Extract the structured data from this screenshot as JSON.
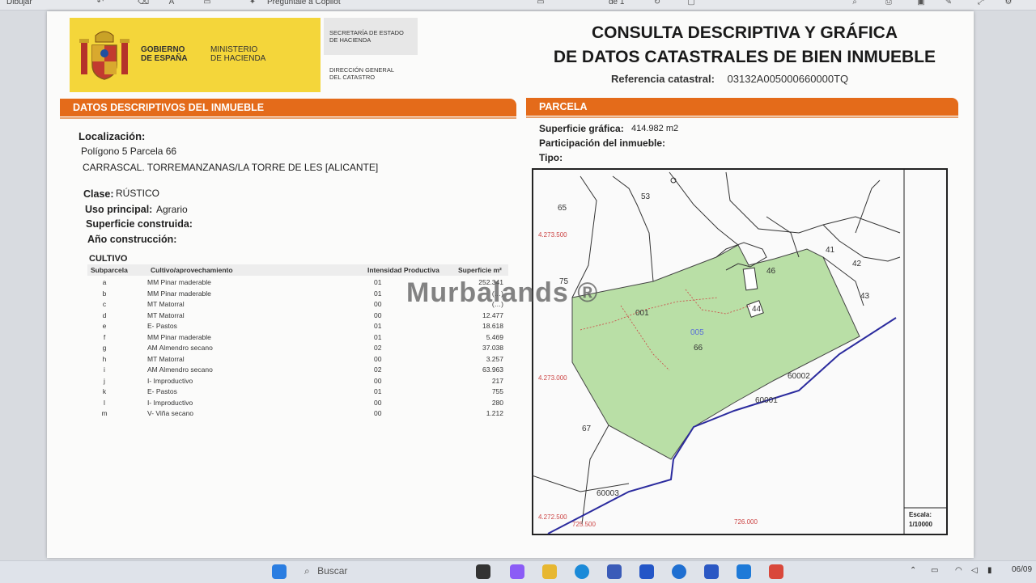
{
  "toolbar": {
    "draw_label": "Dibujar",
    "copilot_label": "Pregúntale a Copilot",
    "page_of": "de 1"
  },
  "header": {
    "gov_line1": "Gobierno",
    "gov_line2": "de España",
    "min_line1": "Ministerio",
    "min_line2": "de Hacienda",
    "sec_line1": "Secretaría de Estado",
    "sec_line2": "de Hacienda",
    "dir_line1": "Dirección General",
    "dir_line2": "del Catastro",
    "title_line1": "CONSULTA DESCRIPTIVA Y GRÁFICA",
    "title_line2": "DE DATOS CATASTRALES DE BIEN INMUEBLE",
    "ref_label": "Referencia catastral:",
    "ref_value": "03132A005000660000TQ"
  },
  "descriptivos": {
    "section_title": "DATOS DESCRIPTIVOS DEL INMUEBLE",
    "localizacion_label": "Localización:",
    "localizacion_line1": "Polígono 5 Parcela 66",
    "localizacion_line2": "CARRASCAL. TORREMANZANAS/LA TORRE DE LES [ALICANTE]",
    "clase_label": "Clase:",
    "clase_value": "RÚSTICO",
    "uso_label": "Uso principal:",
    "uso_value": "Agrario",
    "superficie_label": "Superficie construida:",
    "anio_label": "Año construcción:"
  },
  "cultivo": {
    "title": "CULTIVO",
    "headers": {
      "subparcela": "Subparcela",
      "cultivo": "Cultivo/aprovechamiento",
      "intensidad": "Intensidad Productiva",
      "superficie": "Superficie m²"
    },
    "rows": [
      {
        "sp": "a",
        "cultivo": "MM Pinar maderable",
        "ip": "01",
        "sup": "252.341"
      },
      {
        "sp": "b",
        "cultivo": "MM Pinar maderable",
        "ip": "01",
        "sup": "(…)"
      },
      {
        "sp": "c",
        "cultivo": "MT Matorral",
        "ip": "00",
        "sup": "(…)"
      },
      {
        "sp": "d",
        "cultivo": "MT Matorral",
        "ip": "00",
        "sup": "12.477"
      },
      {
        "sp": "e",
        "cultivo": "E- Pastos",
        "ip": "01",
        "sup": "18.618"
      },
      {
        "sp": "f",
        "cultivo": "MM Pinar maderable",
        "ip": "01",
        "sup": "5.469"
      },
      {
        "sp": "g",
        "cultivo": "AM Almendro secano",
        "ip": "02",
        "sup": "37.038"
      },
      {
        "sp": "h",
        "cultivo": "MT Matorral",
        "ip": "00",
        "sup": "3.257"
      },
      {
        "sp": "i",
        "cultivo": "AM Almendro secano",
        "ip": "02",
        "sup": "63.963"
      },
      {
        "sp": "j",
        "cultivo": "I- Improductivo",
        "ip": "00",
        "sup": "217"
      },
      {
        "sp": "k",
        "cultivo": "E- Pastos",
        "ip": "01",
        "sup": "755"
      },
      {
        "sp": "l",
        "cultivo": "I- Improductivo",
        "ip": "00",
        "sup": "280"
      },
      {
        "sp": "m",
        "cultivo": "V- Viña secano",
        "ip": "00",
        "sup": "1.212"
      }
    ]
  },
  "parcela": {
    "section_title": "PARCELA",
    "superficie_label": "Superficie gráfica:",
    "superficie_value": "414.982 m2",
    "participacion_label": "Participación del inmueble:",
    "tipo_label": "Tipo:"
  },
  "map": {
    "parcel_numbers": [
      "53",
      "65",
      "75",
      "41",
      "42",
      "43",
      "46",
      "44",
      "66",
      "67",
      "005",
      "001",
      "60002",
      "60001",
      "60003"
    ],
    "coord_labels": [
      "4.273.500",
      "4.273.000",
      "4.272.500",
      "725.500",
      "726.000"
    ],
    "escala_label": "Escala:",
    "escala_value": "1/10000"
  },
  "watermark": "Murbalands ®",
  "taskbar": {
    "search_label": "Buscar",
    "date": "06/09"
  }
}
